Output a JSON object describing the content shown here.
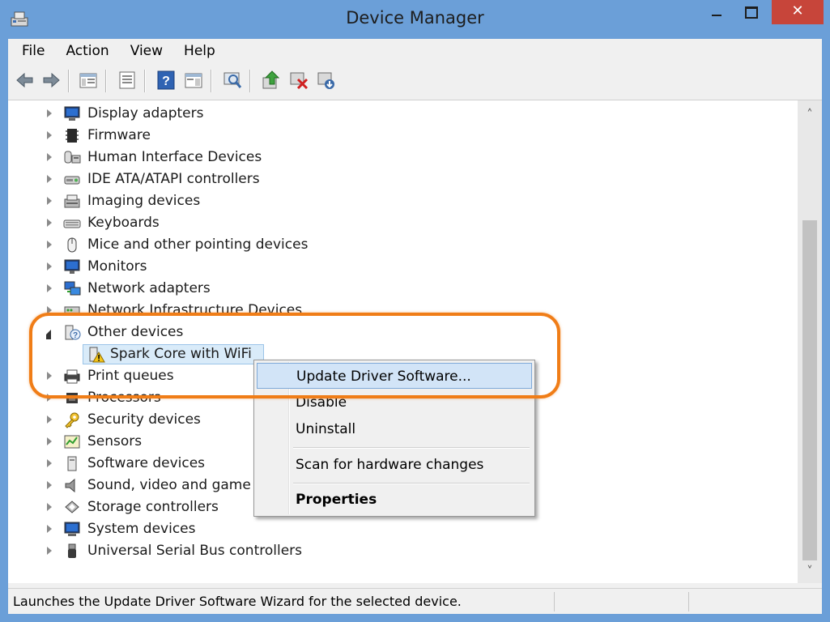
{
  "window": {
    "title": "Device Manager",
    "close_glyph": "✕"
  },
  "menu": [
    "File",
    "Action",
    "View",
    "Help"
  ],
  "toolbar": {
    "icons": [
      "back-arrow-icon",
      "forward-arrow-icon",
      "show-hide-console-tree-icon",
      "properties-icon",
      "help-icon",
      "action-pane-icon",
      "scan-hardware-icon",
      "update-driver-icon",
      "uninstall-icon",
      "enable-device-icon"
    ]
  },
  "tree": {
    "items": [
      {
        "label": "Display adapters",
        "icon": "display-adapter-icon"
      },
      {
        "label": "Firmware",
        "icon": "firmware-icon"
      },
      {
        "label": "Human Interface Devices",
        "icon": "hid-icon"
      },
      {
        "label": "IDE ATA/ATAPI controllers",
        "icon": "ide-controller-icon"
      },
      {
        "label": "Imaging devices",
        "icon": "imaging-device-icon"
      },
      {
        "label": "Keyboards",
        "icon": "keyboard-icon"
      },
      {
        "label": "Mice and other pointing devices",
        "icon": "mouse-icon"
      },
      {
        "label": "Monitors",
        "icon": "monitor-icon"
      },
      {
        "label": "Network adapters",
        "icon": "network-adapter-icon"
      },
      {
        "label": "Network Infrastructure Devices",
        "icon": "network-infrastructure-icon"
      },
      {
        "label": "Other devices",
        "icon": "unknown-device-icon",
        "expanded": true
      },
      {
        "label": "Spark Core with WiFi",
        "icon": "warning-device-icon",
        "child": true,
        "selected": true
      },
      {
        "label": "Print queues",
        "icon": "printer-icon"
      },
      {
        "label": "Processors",
        "icon": "processor-icon"
      },
      {
        "label": "Security devices",
        "icon": "security-key-icon"
      },
      {
        "label": "Sensors",
        "icon": "sensor-icon"
      },
      {
        "label": "Software devices",
        "icon": "software-device-icon"
      },
      {
        "label": "Sound, video and game c",
        "icon": "speaker-icon"
      },
      {
        "label": "Storage controllers",
        "icon": "storage-controller-icon"
      },
      {
        "label": "System devices",
        "icon": "system-device-icon"
      },
      {
        "label": "Universal Serial Bus controllers",
        "icon": "usb-icon"
      }
    ]
  },
  "scrollbar": {
    "up": "˄",
    "down": "˅"
  },
  "context_menu": {
    "items": [
      {
        "label": "Update Driver Software...",
        "highlighted": true
      },
      {
        "label": "Disable"
      },
      {
        "label": "Uninstall"
      },
      {
        "label": "Scan for hardware changes"
      },
      {
        "label": "Properties",
        "bold": true
      }
    ]
  },
  "status": {
    "text": "Launches the Update Driver Software Wizard for the selected device."
  },
  "colors": {
    "accent_window": "#6b9fd8",
    "close_button": "#c7453a",
    "highlight_ring": "#f07d17",
    "selection": "#d9ebf9"
  }
}
